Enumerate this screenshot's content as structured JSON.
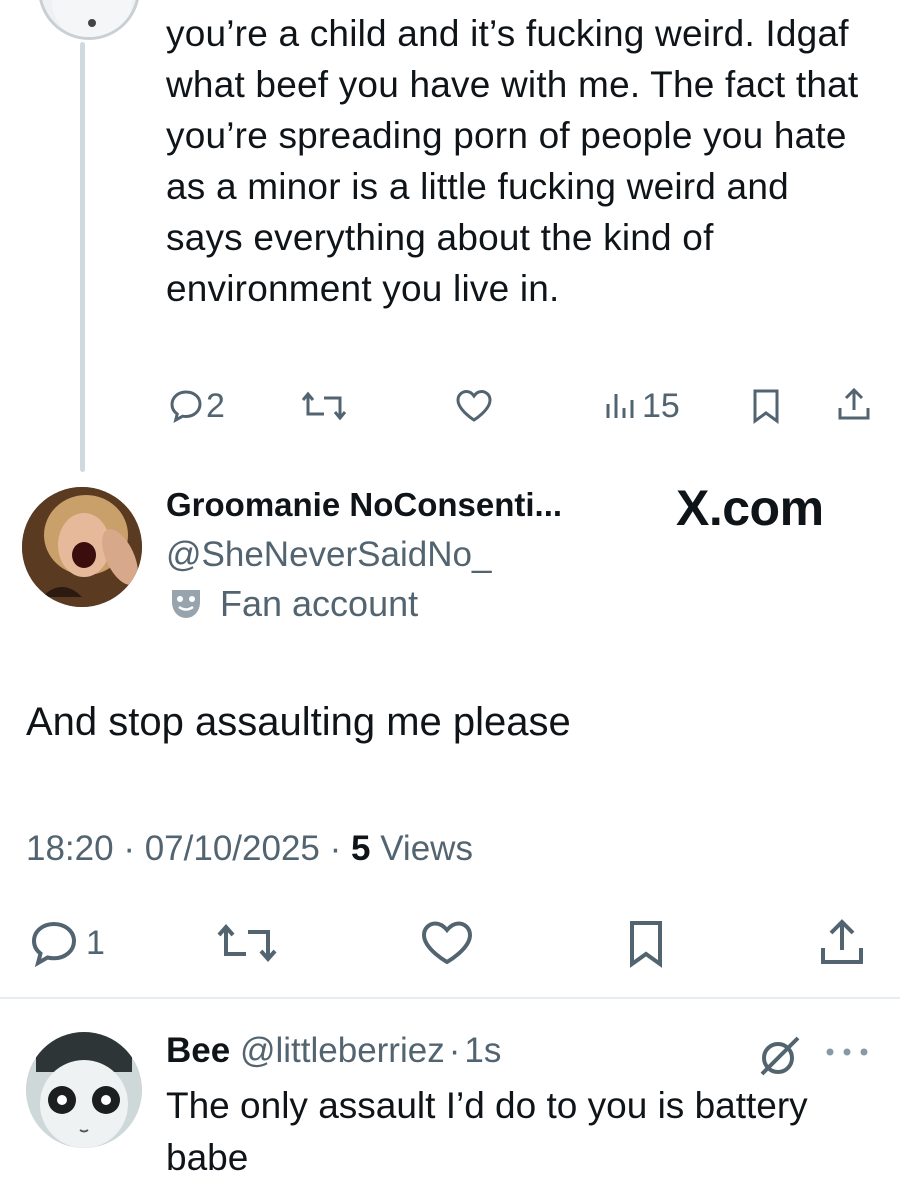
{
  "previous_tweet": {
    "text": "you’re a child and it’s fucking weird. Idgaf what beef you have with me. The fact that you’re spreading porn of people you hate as a minor is a little fucking weird and says everything about the kind of environment you live in.",
    "reply_count": "2",
    "view_count": "15"
  },
  "main_tweet": {
    "display_name": "Groomanie NoConsenti...",
    "handle": "@SheNeverSaidNo_",
    "label": "Fan account",
    "watermark": "X.com",
    "text": "And stop assaulting me please",
    "time": "18:20",
    "date": "07/10/2025",
    "views_count": "5",
    "views_label": "Views",
    "separator": "·",
    "reply_count": "1"
  },
  "reply": {
    "display_name": "Bee",
    "handle": "@littleberriez",
    "separator": "·",
    "age": "1s",
    "text": "The only assault I’d do to you is battery babe"
  },
  "icons": {
    "reply": "reply-icon",
    "retweet": "retweet-icon",
    "like": "heart-icon",
    "views": "views-icon",
    "bookmark": "bookmark-icon",
    "share": "share-icon",
    "fan": "masks-icon",
    "grok": "grok-icon",
    "more": "more-icon"
  },
  "colors": {
    "text": "#0f1419",
    "muted": "#536471",
    "divider": "#e6ecf0",
    "thread_line": "#cfd9de"
  }
}
